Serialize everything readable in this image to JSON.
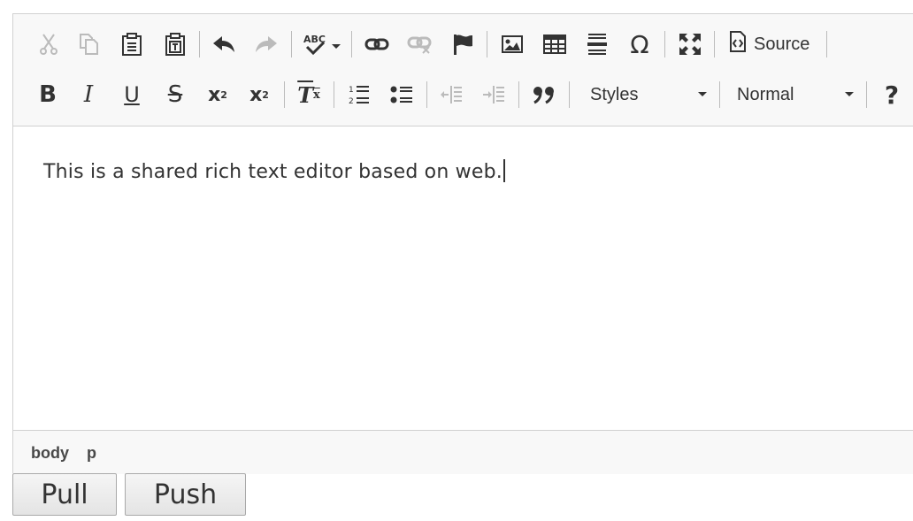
{
  "toolbar": {
    "row1": [
      {
        "name": "cut-icon",
        "enabled": false
      },
      {
        "name": "copy-icon",
        "enabled": false
      },
      {
        "name": "paste-icon",
        "enabled": true
      },
      {
        "name": "paste-as-text-icon",
        "enabled": true
      },
      {
        "name": "undo-icon",
        "enabled": true
      },
      {
        "name": "redo-icon",
        "enabled": false
      },
      {
        "name": "spellcheck-icon",
        "enabled": true
      },
      {
        "name": "link-icon",
        "enabled": true
      },
      {
        "name": "unlink-icon",
        "enabled": false
      },
      {
        "name": "anchor-flag-icon",
        "enabled": true
      },
      {
        "name": "image-icon",
        "enabled": true
      },
      {
        "name": "table-icon",
        "enabled": true
      },
      {
        "name": "horizontal-line-icon",
        "enabled": true
      },
      {
        "name": "special-char-icon",
        "enabled": true
      },
      {
        "name": "maximize-icon",
        "enabled": true
      }
    ],
    "source_label": "Source",
    "styles_label": "Styles",
    "format_label": "Normal",
    "help_glyph": "?",
    "special_char_glyph": "Ω"
  },
  "editor": {
    "text": "This is a shared rich text editor based on web."
  },
  "statusbar": {
    "path": [
      "body",
      "p"
    ]
  },
  "buttons": {
    "pull": "Pull",
    "push": "Push"
  },
  "colors": {
    "enabled_icon": "#333333",
    "disabled_icon": "#bbbbbb",
    "toolbar_bg": "#f8f8f8",
    "border": "#d1d1d1"
  }
}
